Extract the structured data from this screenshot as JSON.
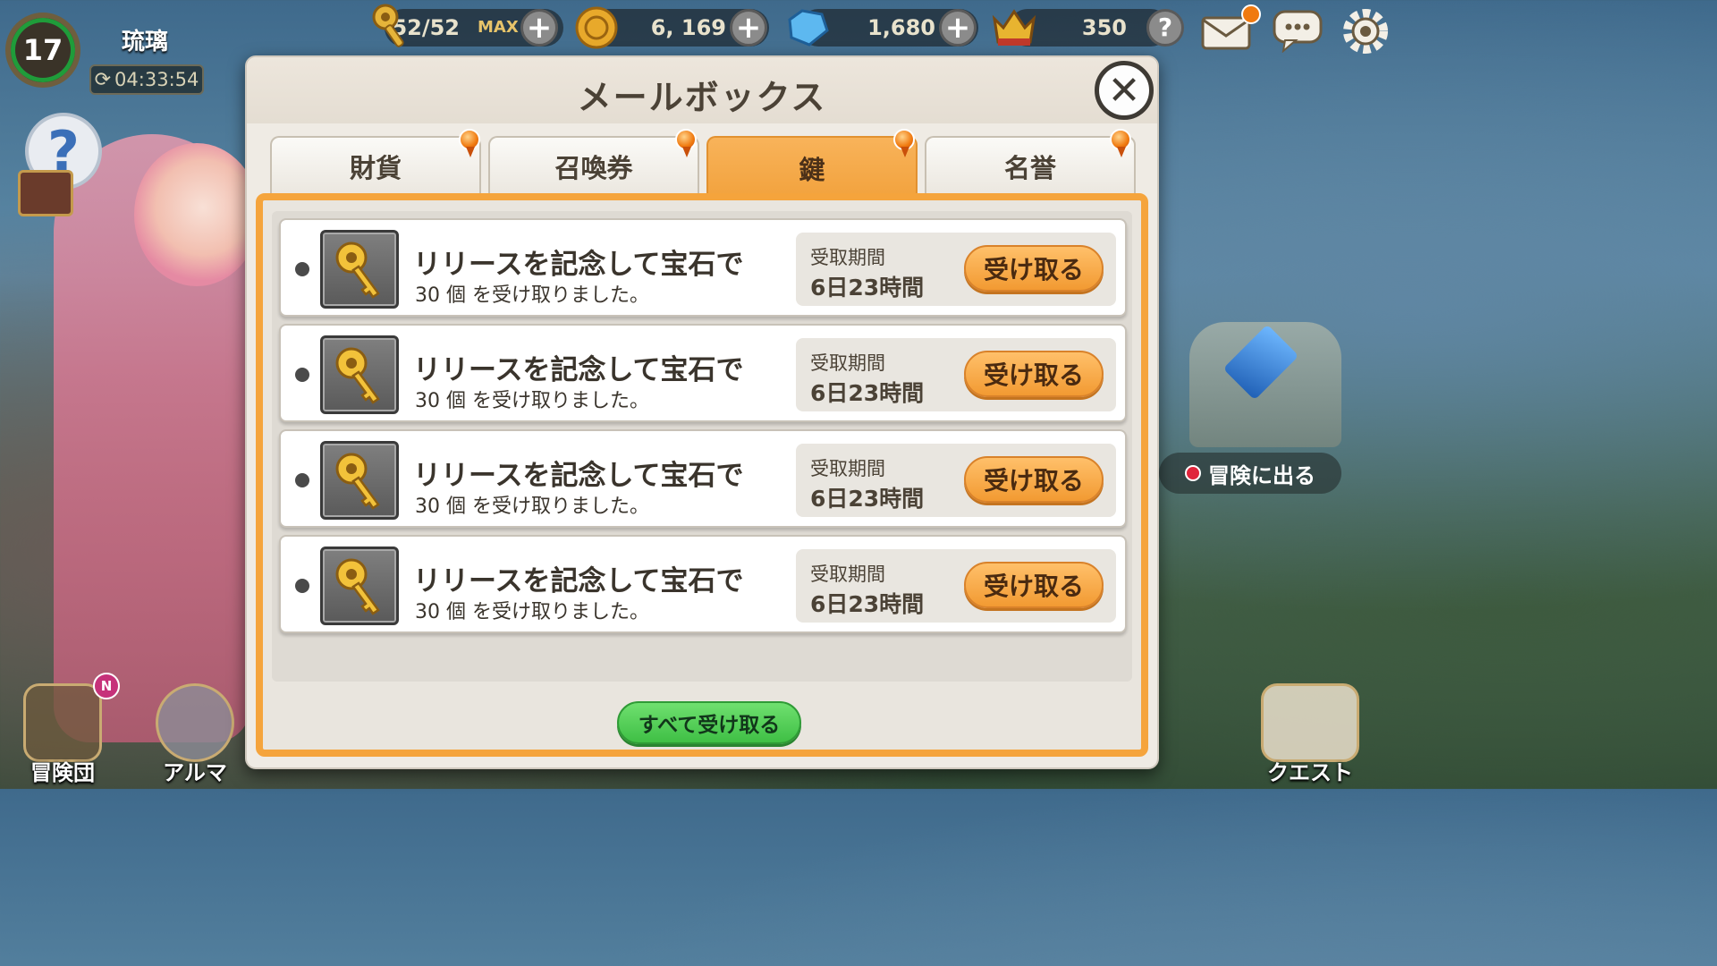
{
  "hud": {
    "level": "17",
    "player_name": "琉璃",
    "timer": "04:33:54",
    "stamina": "52/52",
    "stamina_max_tag": "MAX",
    "gold": "6, 169",
    "gems": "1,680",
    "honor": "350",
    "help_glyph": "?",
    "plus_glyph": "+"
  },
  "modal": {
    "title": "メールボックス",
    "close_glyph": "✕",
    "tabs": [
      {
        "label": "財貨",
        "active": false
      },
      {
        "label": "召喚券",
        "active": false
      },
      {
        "label": "鍵",
        "active": true
      },
      {
        "label": "名誉",
        "active": false
      }
    ],
    "mails": [
      {
        "title": "リリースを記念して宝石で",
        "sub": "30 個 を受け取りました。",
        "period_label": "受取期間",
        "period_value": "6日23時間",
        "button": "受け取る"
      },
      {
        "title": "リリースを記念して宝石で",
        "sub": "30 個 を受け取りました。",
        "period_label": "受取期間",
        "period_value": "6日23時間",
        "button": "受け取る"
      },
      {
        "title": "リリースを記念して宝石で",
        "sub": "30 個 を受け取りました。",
        "period_label": "受取期間",
        "period_value": "6日23時間",
        "button": "受け取る"
      },
      {
        "title": "リリースを記念して宝石で",
        "sub": "30 個 を受け取りました。",
        "period_label": "受取期間",
        "period_value": "6日23時間",
        "button": "受け取る"
      }
    ],
    "receive_all": "すべて受け取る"
  },
  "scene": {
    "adventure_button": "冒険に出る",
    "nav": [
      {
        "label": "冒険団",
        "icon": "backpack-icon"
      },
      {
        "label": "アルマ",
        "icon": "knight-helmet-icon"
      },
      {
        "label": "クエスト",
        "icon": "book-icon"
      }
    ],
    "nav_badge": "N"
  },
  "colors": {
    "tab_active": "#f2a23d",
    "receive_button": "#f29a32",
    "receive_all_button": "#3fbf45",
    "frame": "#f5a43c"
  }
}
